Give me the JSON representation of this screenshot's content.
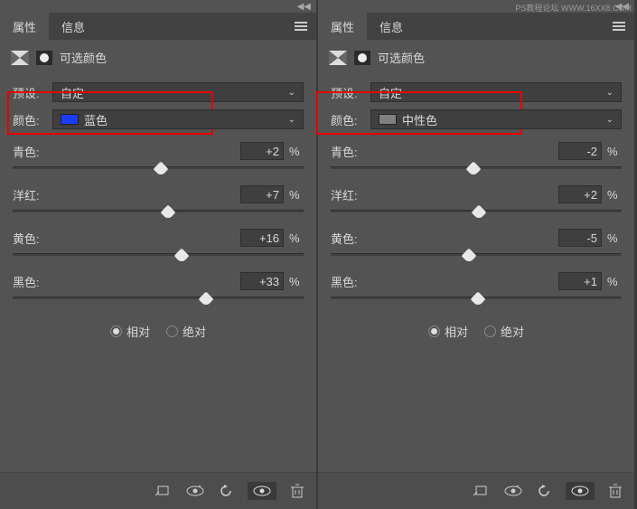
{
  "watermark": "PS教程论坛 WWW.16XX8.COM",
  "tabs": {
    "properties": "属性",
    "info": "信息"
  },
  "adj_title": "可选颜色",
  "preset_label": "预设:",
  "color_label": "颜色:",
  "preset_value": "自定",
  "sliders": {
    "cyan": "青色:",
    "magenta": "洋红:",
    "yellow": "黄色:",
    "black": "黑色:",
    "pct": "%"
  },
  "radios": {
    "relative": "相对",
    "absolute": "绝对"
  },
  "left": {
    "color_name": "蓝色",
    "swatch": "#1a3cff",
    "cyan": "+2",
    "magenta": "+7",
    "yellow": "+16",
    "black": "+33"
  },
  "right": {
    "color_name": "中性色",
    "swatch": "#808080",
    "cyan": "-2",
    "magenta": "+2",
    "yellow": "-5",
    "black": "+1"
  }
}
